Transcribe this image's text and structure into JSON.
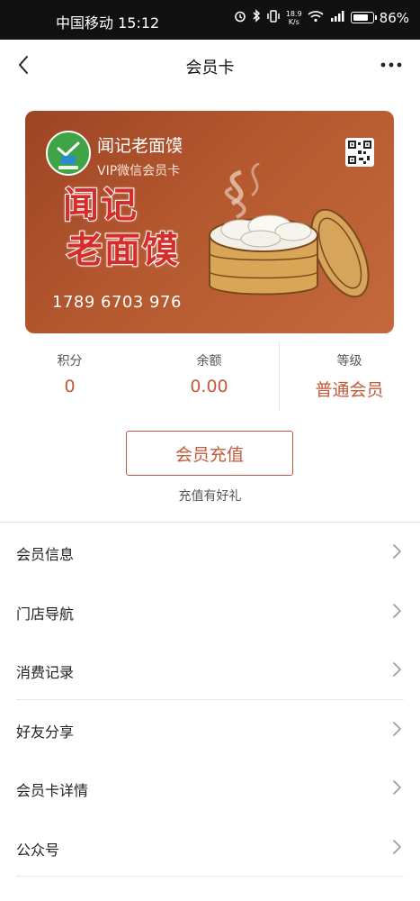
{
  "status_bar": {
    "carrier_time": "中国移动 15:12",
    "net_speed": "18.9\nK/s",
    "net_speed_top": "18.9",
    "net_speed_bottom": "K/s",
    "signal_type": "4G",
    "battery": "86%",
    "battery_level": 0.86,
    "icons": [
      "alarm-icon",
      "bluetooth-icon",
      "vibrate-icon",
      "wifi-icon",
      "signal-icon",
      "battery-icon"
    ]
  },
  "nav": {
    "title": "会员卡",
    "back_icon": "back-chevron-icon",
    "more_icon": "more-dots-icon"
  },
  "card": {
    "store_name": "闻记老面馍",
    "card_type": "VIP微信会员卡",
    "brand_line1": "闻记",
    "brand_line2": "老面馍",
    "number": "1789 6703 976",
    "logo_icon": "store-logo-icon",
    "qr_icon": "qr-code-icon",
    "colors": {
      "card_start": "#9c4424",
      "card_end": "#c4693c",
      "brand_text": "#d52e2a"
    }
  },
  "stats": [
    {
      "label": "积分",
      "value": "0"
    },
    {
      "label": "余额",
      "value": "0.00"
    },
    {
      "label": "等级",
      "value": "普通会员"
    }
  ],
  "recharge": {
    "button_label": "会员充值",
    "tip": "充值有好礼"
  },
  "menu": [
    {
      "label": "会员信息"
    },
    {
      "label": "门店导航"
    },
    {
      "label": "消费记录"
    },
    {
      "label": "好友分享"
    },
    {
      "label": "会员卡详情"
    },
    {
      "label": "公众号"
    }
  ],
  "accent_color": "#c6583a"
}
